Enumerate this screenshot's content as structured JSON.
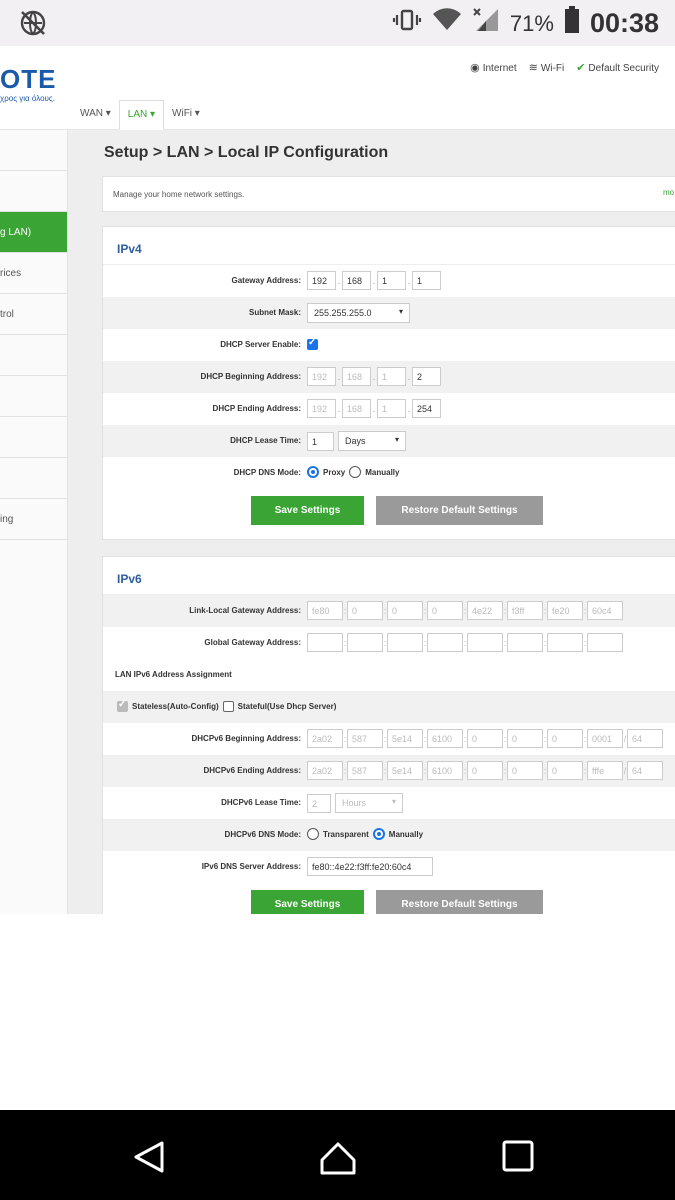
{
  "status_bar": {
    "icons": [
      "globe-crossed-icon",
      "vibrate-icon",
      "wifi-icon",
      "signal-icon",
      "battery-icon"
    ],
    "battery": "71%",
    "time": "00:38"
  },
  "header": {
    "logo_text": "OTE",
    "logo_subtext": "χρος για όλους.",
    "links": [
      {
        "icon": "globe-icon",
        "label": "Internet"
      },
      {
        "icon": "wifi-icon",
        "label": "Wi-Fi"
      },
      {
        "icon": "check-circle-icon",
        "label": "Default Security"
      }
    ],
    "tabs": [
      {
        "label": "WAN ▾"
      },
      {
        "label": "LAN ▾"
      },
      {
        "label": "WiFi ▾"
      }
    ]
  },
  "sidebar": {
    "items": [
      "",
      "",
      "g LAN)",
      "rices",
      "trol",
      "",
      "",
      "",
      "",
      "ing"
    ]
  },
  "main": {
    "title": "Setup > LAN > Local IP Configuration",
    "info_text": "Manage your home network settings.",
    "info_more": "mo",
    "ipv4": {
      "title": "IPv4",
      "gateway_label": "Gateway Address:",
      "gateway": [
        "192",
        "168",
        "1",
        "1"
      ],
      "subnet_label": "Subnet Mask:",
      "subnet": "255.255.255.0",
      "dhcp_enable_label": "DHCP Server Enable:",
      "dhcp_begin_label": "DHCP Beginning Address:",
      "dhcp_begin": [
        "192",
        "168",
        "1",
        "2"
      ],
      "dhcp_end_label": "DHCP Ending Address:",
      "dhcp_end": [
        "192",
        "168",
        "1",
        "254"
      ],
      "lease_label": "DHCP Lease Time:",
      "lease_value": "1",
      "lease_unit": "Days",
      "dns_label": "DHCP DNS Mode:",
      "dns_opt1": "Proxy",
      "dns_opt2": "Manually",
      "save": "Save Settings",
      "restore": "Restore Default Settings"
    },
    "ipv6": {
      "title": "IPv6",
      "link_local_label": "Link-Local Gateway Address:",
      "link_local": [
        "fe80",
        "0",
        "0",
        "0",
        "4e22",
        "f3ff",
        "fe20",
        "60c4"
      ],
      "global_label": "Global Gateway Address:",
      "assign_label": "LAN IPv6 Address Assignment",
      "stateless": "Stateless(Auto-Config)",
      "stateful": "Stateful(Use Dhcp Server)",
      "begin_label": "DHCPv6 Beginning Address:",
      "begin": [
        "2a02",
        "587",
        "5e14",
        "6100",
        "0",
        "0",
        "0",
        "0001"
      ],
      "begin_prefix": "64",
      "end_label": "DHCPv6 Ending Address:",
      "end": [
        "2a02",
        "587",
        "5e14",
        "6100",
        "0",
        "0",
        "0",
        "fffe"
      ],
      "end_prefix": "64",
      "lease_label": "DHCPv6 Lease Time:",
      "lease_value": "2",
      "lease_unit": "Hours",
      "dns_label": "DHCPv6 DNS Mode:",
      "dns_opt1": "Transparent",
      "dns_opt2": "Manually",
      "dns_server_label": "IPv6 DNS Server Address:",
      "dns_server": "fe80::4e22:f3ff:fe20:60c4",
      "save": "Save Settings",
      "restore": "Restore Default Settings"
    }
  },
  "colors": {
    "accent_green": "#3aa535",
    "title_blue": "#2f5e9e",
    "checkbox_blue": "#1a73e8",
    "restore_gray": "#9a9a9a"
  }
}
